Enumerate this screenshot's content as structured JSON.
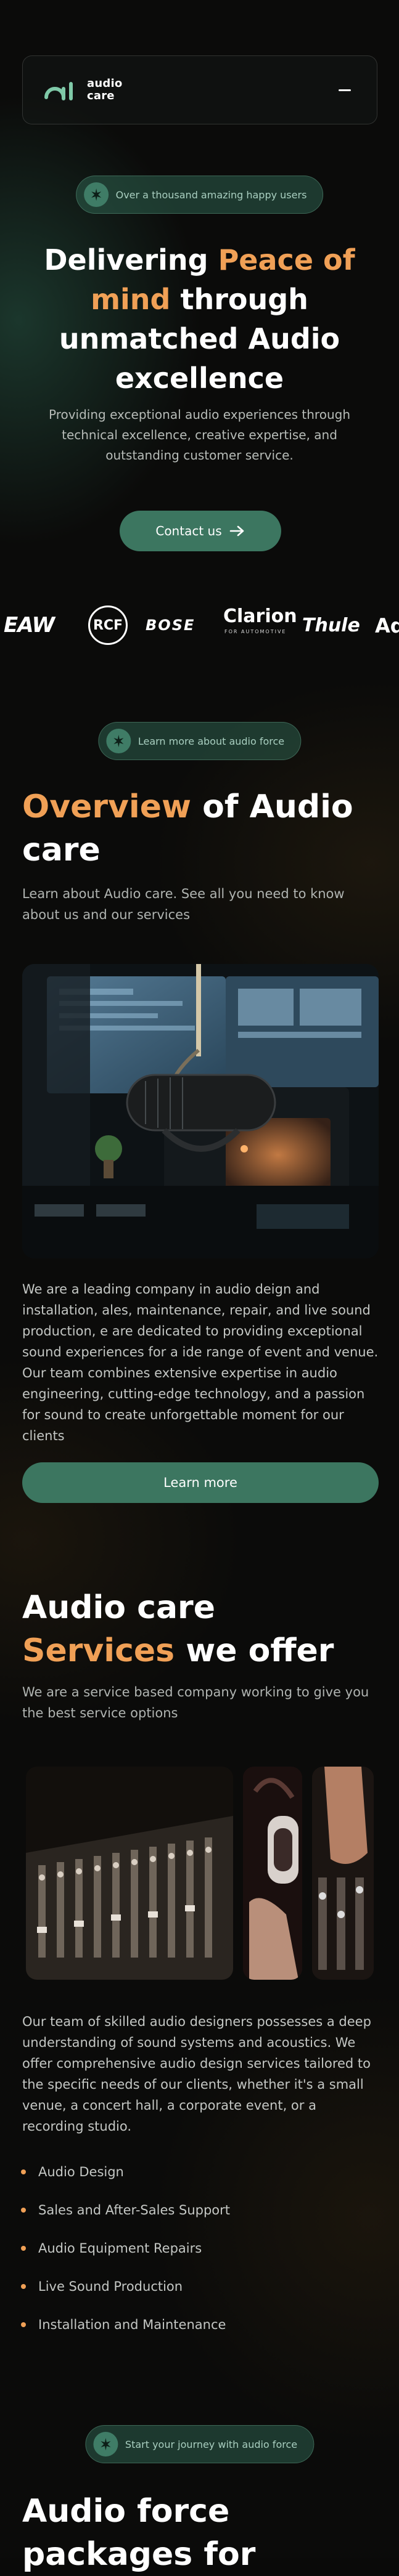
{
  "nav": {
    "logo_line1": "audio",
    "logo_line2": "care",
    "menu_icon": "menu-icon"
  },
  "hero": {
    "badge": "Over a thousand amazing happy users",
    "title_part1": "Delivering ",
    "title_accent": "Peace of mind",
    "title_part2": " through unmatched Audio excellence",
    "subtitle": "Providing exceptional audio experiences through technical excellence, creative expertise, and outstanding customer service.",
    "cta": "Contact us"
  },
  "brands": [
    "EAW",
    "RCF",
    "BOSE",
    "Clarion",
    "FOR AUTOMOTIVE",
    "Thule",
    "Ad"
  ],
  "overview": {
    "badge": "Learn more about audio force",
    "title_accent": "Overview",
    "title_rest": " of Audio care",
    "lead": "Learn about Audio care. See all you need to know about us and our services",
    "body": "We are a leading company in audio deign and installation, ales, maintenance, repair, and live sound production, e are dedicated to providing exceptional sound experiences for a ide range of event and venue. Our team combines extensive expertise in audio engineering, cutting-edge technology, and a passion for sound to create unforgettable moment for our clients",
    "cta": "Learn more"
  },
  "services": {
    "title_line1": "Audio care",
    "title_accent": "Services",
    "title_rest": " we offer",
    "lead": "We are a service based company working to give you the best service options",
    "body": "Our team of skilled audio designers possesses a deep understanding of sound systems and acoustics. We offer comprehensive audio design services tailored to the specific needs of our clients, whether it's a small venue, a concert hall, a corporate event, or a recording studio.",
    "items": [
      "Audio Design",
      "Sales and After-Sales Support",
      "Audio Equipment Repairs",
      "Live Sound Production",
      "Installation and Maintenance"
    ]
  },
  "packages": {
    "badge": "Start your journey with audio force",
    "title": "Audio force packages for"
  },
  "colors": {
    "accent": "#f0a056",
    "primary_green": "#3c7660",
    "background": "#0b0b0a"
  }
}
